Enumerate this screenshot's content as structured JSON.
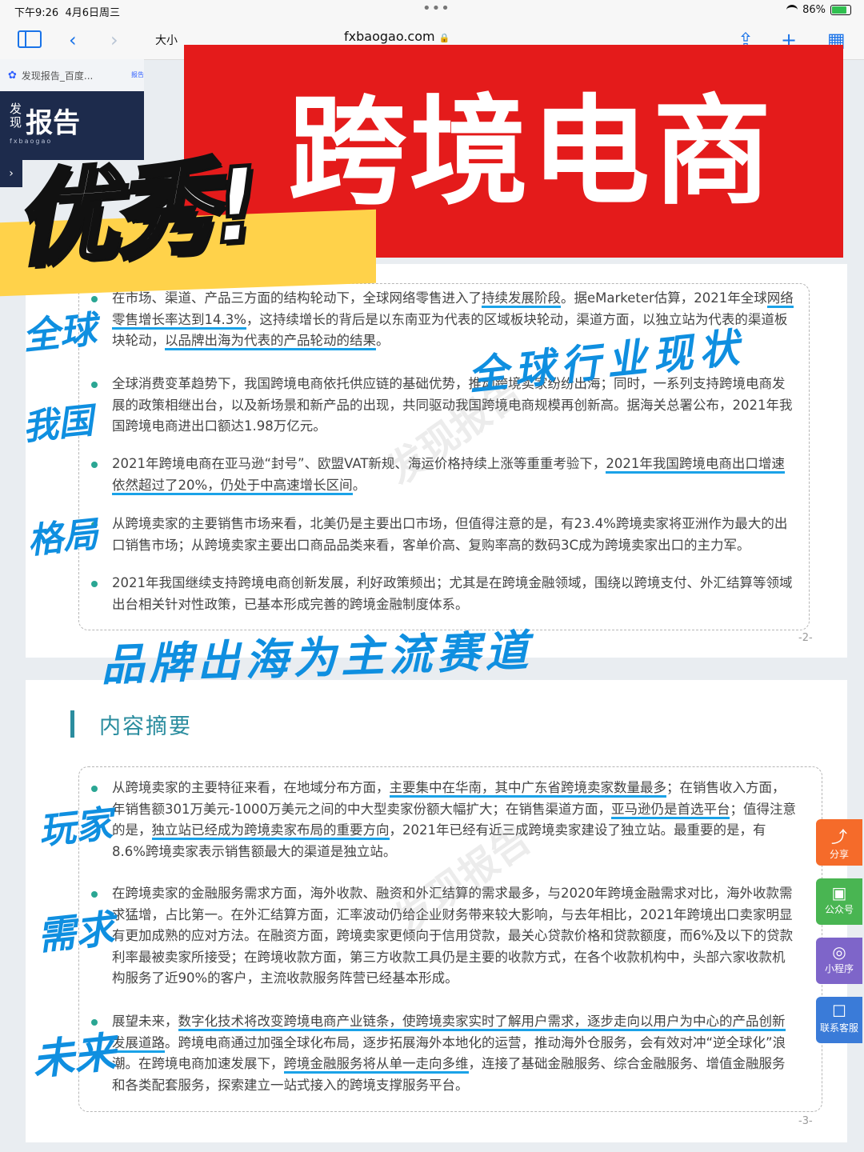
{
  "status_bar": {
    "time": "下午9:26",
    "date": "4月6日周三",
    "battery": "86%"
  },
  "browser": {
    "reader_label": "大小",
    "url": "fxbaogao.com",
    "tab_title": "发现报告_百度...",
    "tab_badge": "报告"
  },
  "site": {
    "logo_small": "发现",
    "logo_big": "报告",
    "logo_sub": "fxbaogao",
    "nav_arrow": "›"
  },
  "banner": {
    "title": "跨境电商",
    "sticker": "优秀!"
  },
  "page1": {
    "bullets": [
      {
        "pre": "在市场、渠道、产品三方面的结构轮动下，全球网络零售进入了",
        "u1": "持续发展阶段",
        "mid": "。据eMarketer估算，2021年全球",
        "u2": "网络零售增长率达到14.3%",
        "post": "，这持续增长的背后是以东南亚为代表的区域板块轮动，渠道方面，以独立站为代表的渠道板块轮动，",
        "u3": "以品牌出海为代表的产品轮动的结果",
        "end": "。"
      },
      {
        "text": "全球消费变革趋势下，我国跨境电商依托供应链的基础优势，推动跨境卖家纷纷出海；同时，一系列支持跨境电商发展的政策相继出台，以及新场景和新产品的出现，共同驱动我国跨境电商规模再创新高。据海关总署公布，2021年我国跨境电商进出口额达1.98万亿元。"
      },
      {
        "pre": "2021年跨境电商在亚马逊“封号”、欧盟VAT新规、海运价格持续上涨等重重考验下，",
        "u1": "2021年我国跨境电商出口增速依然超过了20%，仍处于中高速增长区间",
        "end": "。"
      },
      {
        "text": "从跨境卖家的主要销售市场来看，北美仍是主要出口市场，但值得注意的是，有23.4%跨境卖家将亚洲作为最大的出口销售市场；从跨境卖家主要出口商品品类来看，客单价高、复购率高的数码3C成为跨境卖家出口的主力军。"
      },
      {
        "text": "2021年我国继续支持跨境电商创新发展，利好政策频出；尤其是在跨境金融领域，围绕以跨境支付、外汇结算等领域出台相关针对性政策，已基本形成完善的跨境金融制度体系。"
      }
    ],
    "page_number": "-2-"
  },
  "page2": {
    "section_title": "内容摘要",
    "bullets": [
      {
        "pre": "从跨境卖家的主要特征来看，在地域分布方面，",
        "u1": "主要集中在华南，其中广东省跨境卖家数量最多",
        "mid": "；在销售收入方面，年销售额301万美元-1000万美元之间的中大型卖家份额大幅扩大；在销售渠道方面，",
        "u2": "亚马逊仍是首选平台",
        "post": "；值得注意的是，",
        "u3": "独立站已经成为跨境卖家布局的重要方向",
        "end": "，2021年已经有近三成跨境卖家建设了独立站。最重要的是，有8.6%跨境卖家表示销售额最大的渠道是独立站。"
      },
      {
        "text": "在跨境卖家的金融服务需求方面，海外收款、融资和外汇结算的需求最多，与2020年跨境金融需求对比，海外收款需求猛增，占比第一。在外汇结算方面，汇率波动仍给企业财务带来较大影响，与去年相比，2021年跨境出口卖家明显有更加成熟的应对方法。在融资方面，跨境卖家更倾向于信用贷款，最关心贷款价格和贷款额度，而6%及以下的贷款利率最被卖家所接受；在跨境收款方面，第三方收款工具仍是主要的收款方式，在各个收款机构中，头部六家收款机构服务了近90%的客户，主流收款服务阵营已经基本形成。"
      },
      {
        "pre": "展望未来，",
        "u1": "数字化技术将改变跨境电商产业链条，使跨境卖家实时了解用户需求，逐步走向以用户为中心的产品创新发展道路",
        "mid": "。跨境电商通过加强全球化布局，逐步拓展海外本地化的运营，推动海外仓服务，会有效对冲“逆全球化”浪潮。在跨境电商加速发展下，",
        "u2": "跨境金融服务将从单一走向多维",
        "end": "，连接了基础金融服务、综合金融服务、增值金融服务和各类配套服务，探索建立一站式接入的跨境支撑服务平台。"
      }
    ],
    "page_number": "-3-"
  },
  "handwriting": {
    "quanqiu": "全球",
    "global_status": "全球行业现状",
    "woguo": "我国",
    "geju": "格局",
    "brand_track": "品牌出海为主流赛道",
    "wanjia": "玩家",
    "xuqiu": "需求",
    "weilai": "未来"
  },
  "watermarks": {
    "w1": "发现报告",
    "w2": "发现报告"
  },
  "float_buttons": {
    "share": "分享",
    "gzh": "公众号",
    "mini": "小程序",
    "kefu": "联系客服"
  },
  "colors": {
    "banner_red": "#e41b1b",
    "accent_teal": "#2aa693",
    "ink_blue": "#0f8fe0",
    "sticker_yellow": "#ffd24a"
  }
}
